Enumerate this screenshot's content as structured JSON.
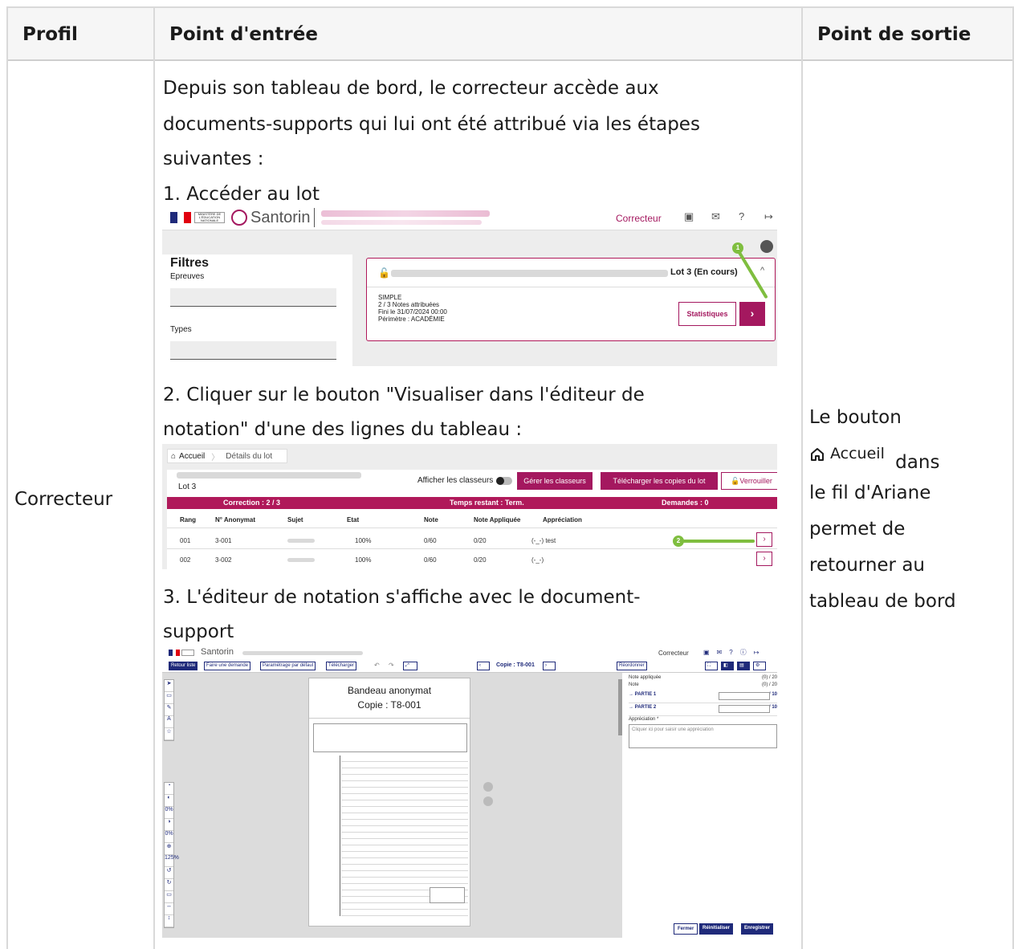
{
  "table": {
    "headers": {
      "profil": "Profil",
      "entry": "Point d'entrée",
      "exit": "Point de sortie"
    },
    "profil_value": "Correcteur",
    "intro_lines": [
      "Depuis son tableau de bord, le correcteur accède aux",
      "documents-supports qui lui ont été attribué via les étapes",
      "suivantes :"
    ],
    "step1": "1. Accéder au lot",
    "step2_lines": [
      "2. Cliquer sur le bouton \"Visualiser dans l'éditeur de",
      "notation\" d'une des lignes du tableau :"
    ],
    "step3_lines": [
      "3. L'éditeur de notation s'affiche avec le document-",
      "support"
    ],
    "exit_text": {
      "line1": "Le bouton",
      "accueil": "Accueil",
      "dans": "dans",
      "rest": [
        "le fil d'Ariane",
        "permet de",
        "retourner au",
        "tableau de bord"
      ]
    }
  },
  "shot1": {
    "app_name": "Santorin",
    "ministry": "MINISTÈRE DE L'ÉDUCATION NATIONALE",
    "role": "Correcteur",
    "filters_title": "Filtres",
    "epreuves": "Epreuves",
    "types": "Types",
    "lot_label": "Lot 3 (En cours)",
    "card_lines": [
      "SIMPLE",
      "2 / 3 Notes attribuées",
      "Fini le 31/07/2024 00:00",
      "Périmètre : ACADÉMIE"
    ],
    "stats_btn": "Statistiques",
    "go_btn": "›",
    "marker": "1"
  },
  "shot2": {
    "breadcrumb_home": "Accueil",
    "breadcrumb_current": "Détails du lot",
    "lot": "Lot 3",
    "afficher": "Afficher les classeurs",
    "btn_gerer": "Gérer les classeurs",
    "btn_telecharger": "Télécharger les copies du lot",
    "btn_verrouiller": "Verrouiller",
    "band": [
      "Correction : 2 / 3",
      "Temps restant : Term.",
      "Demandes : 0"
    ],
    "columns": [
      "Rang",
      "N° Anonymat",
      "Sujet",
      "Etat",
      "Note",
      "Note Appliquée",
      "Appréciation"
    ],
    "rows": [
      [
        "001",
        "3-001",
        "",
        "100%",
        "0/60",
        "0/20",
        "(-_-) test"
      ],
      [
        "002",
        "3-002",
        "",
        "100%",
        "0/60",
        "0/20",
        "(-_-)"
      ]
    ],
    "marker": "2"
  },
  "shot3": {
    "app_name": "Santorin",
    "role": "Correcteur",
    "btn_retour": "Retour liste",
    "btn_demande": "Faire une demande",
    "btn_param": "Paramétrage par défaut",
    "btn_telecharger": "Télécharger",
    "copie": "Copie : T8-001",
    "btn_reordonner": "Réordonner",
    "bandeau": "Bandeau anonymat",
    "copie_paper": "Copie : T8-001",
    "note_appliquee": "Note appliquée",
    "note_appliquee_val": "(0) / 20",
    "note": "Note",
    "note_val": "(0) / 20",
    "partie1": "→ PARTIE 1",
    "partie2": "→ PARTIE 2",
    "sur10": "/ 10",
    "appreciation": "Appréciation *",
    "appreciation_ph": "Cliquer ici pour saisir une appréciation",
    "zoom_values": [
      "0%",
      "0%",
      "125%"
    ],
    "btn_fermer": "Fermer",
    "btn_reinit": "Réinitialiser",
    "btn_enregistrer": "Enregistrer"
  }
}
